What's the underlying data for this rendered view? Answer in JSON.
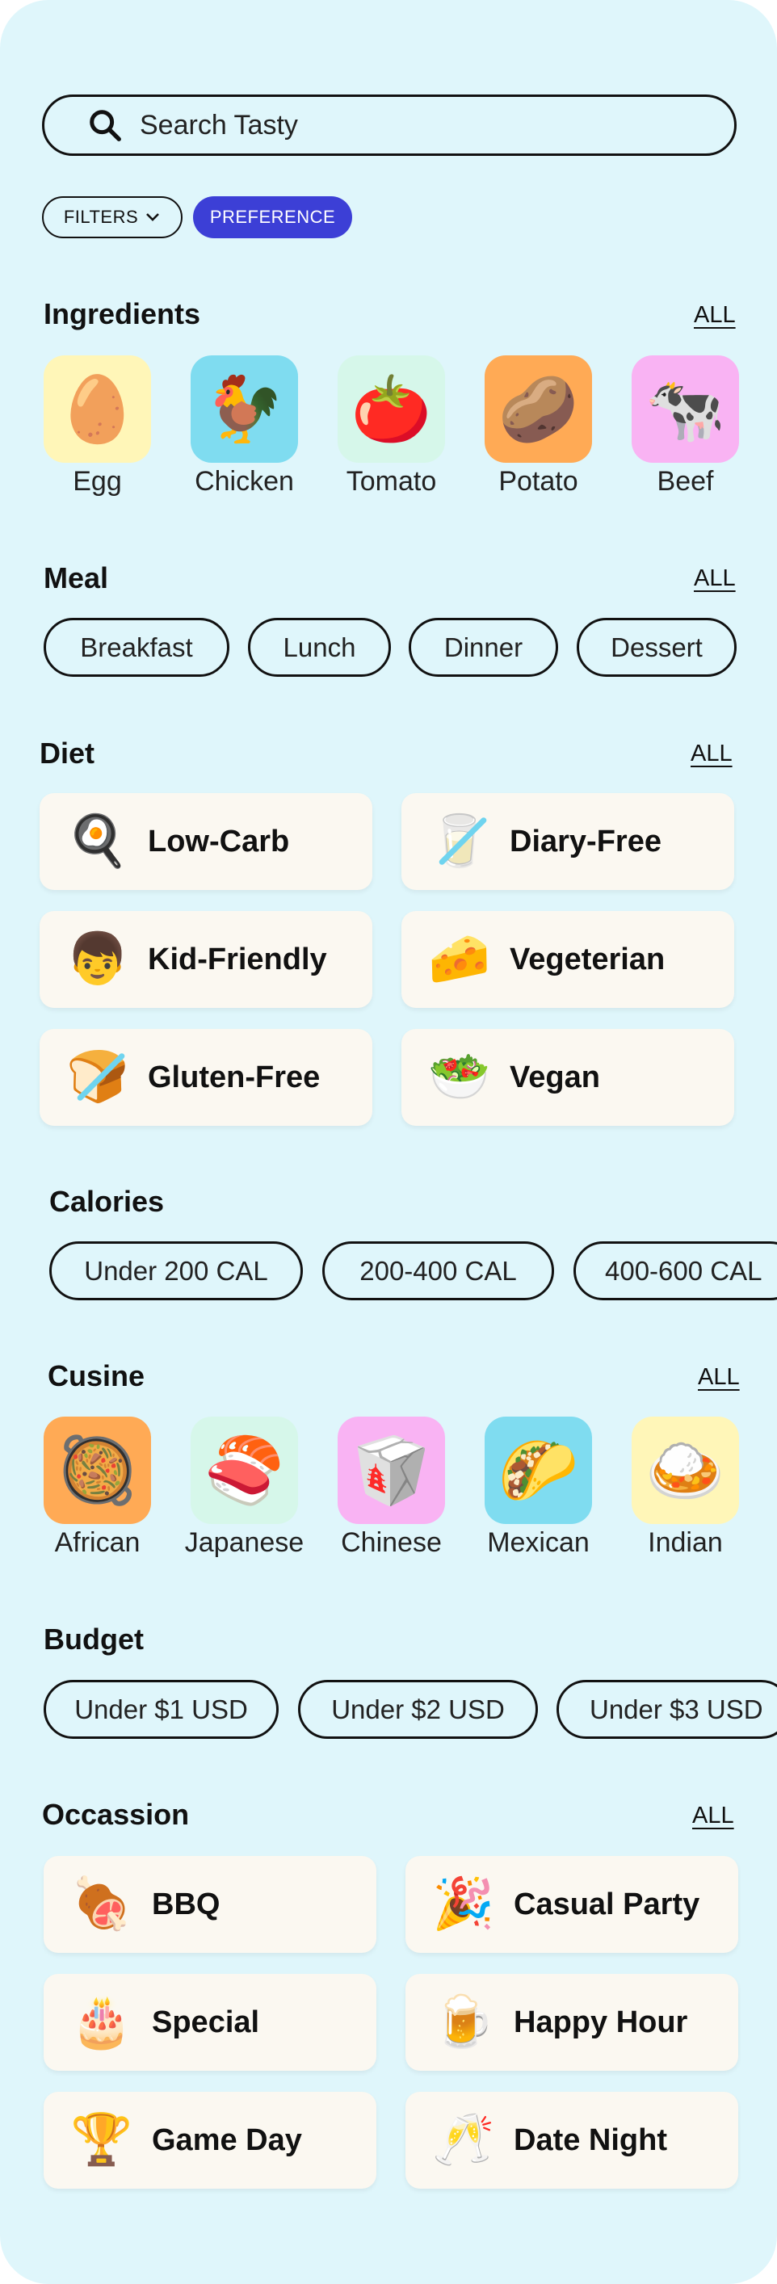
{
  "search": {
    "placeholder": "Search Tasty",
    "icon": "search-icon"
  },
  "filters": {
    "filters_label": "FILTERS",
    "preference_label": "PREFERENCE",
    "accent": "#3c3fd6"
  },
  "ingredients": {
    "title": "Ingredients",
    "all": "ALL",
    "items": [
      {
        "label": "Egg",
        "icon": "🥚",
        "bg": "#fff6b8"
      },
      {
        "label": "Chicken",
        "icon": "🐓",
        "bg": "#7fdcf0"
      },
      {
        "label": "Tomato",
        "icon": "🍅",
        "bg": "#d6f7ea"
      },
      {
        "label": "Potato",
        "icon": "🥔",
        "bg": "#ffaa55"
      },
      {
        "label": "Beef",
        "icon": "🐄",
        "bg": "#f9b3f3"
      }
    ]
  },
  "meal": {
    "title": "Meal",
    "all": "ALL",
    "chips": [
      "Breakfast",
      "Lunch",
      "Dinner",
      "Dessert"
    ]
  },
  "diet": {
    "title": "Diet",
    "all": "ALL",
    "cards": [
      {
        "label": "Low-Carb",
        "icon": "🍳"
      },
      {
        "label": "Diary-Free",
        "icon": "🥛"
      },
      {
        "label": "Kid-Friendly",
        "icon": "👦"
      },
      {
        "label": "Vegeterian",
        "icon": "🧀"
      },
      {
        "label": "Gluten-Free",
        "icon": "🍞"
      },
      {
        "label": "Vegan",
        "icon": "🥗"
      }
    ]
  },
  "calories": {
    "title": "Calories",
    "chips": [
      "Under 200 CAL",
      "200-400 CAL",
      "400-600 CAL"
    ]
  },
  "cuisine": {
    "title": "Cusine",
    "all": "ALL",
    "items": [
      {
        "label": "African",
        "icon": "🥘",
        "bg": "#ffaa55"
      },
      {
        "label": "Japanese",
        "icon": "🍣",
        "bg": "#d6f7ea"
      },
      {
        "label": "Chinese",
        "icon": "🥡",
        "bg": "#f9b3f3"
      },
      {
        "label": "Mexican",
        "icon": "🌮",
        "bg": "#7fdcf0"
      },
      {
        "label": "Indian",
        "icon": "🍛",
        "bg": "#fff6b8"
      }
    ]
  },
  "budget": {
    "title": "Budget",
    "chips": [
      "Under $1 USD",
      "Under $2 USD",
      "Under $3 USD"
    ]
  },
  "occasion": {
    "title": "Occassion",
    "all": "ALL",
    "cards": [
      {
        "label": "BBQ",
        "icon": "🍖"
      },
      {
        "label": "Casual Party",
        "icon": "🎉"
      },
      {
        "label": "Special",
        "icon": "🎂"
      },
      {
        "label": "Happy Hour",
        "icon": "🍺"
      },
      {
        "label": "Game Day",
        "icon": "🏆"
      },
      {
        "label": "Date Night",
        "icon": "🥂"
      }
    ]
  }
}
